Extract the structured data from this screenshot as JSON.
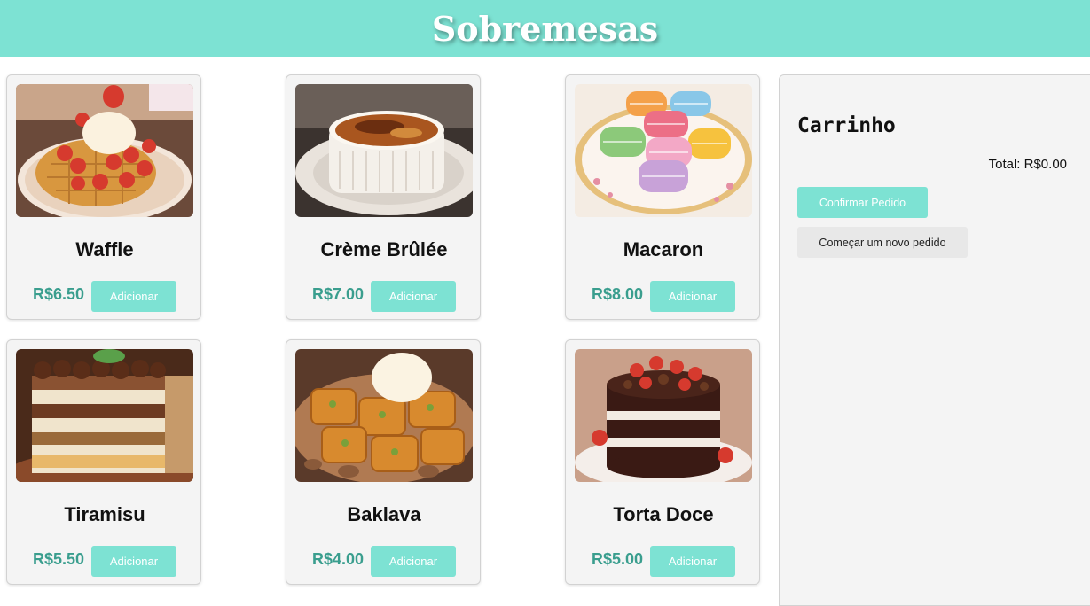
{
  "header": {
    "title": "Sobremesas"
  },
  "products": [
    {
      "name": "Waffle",
      "price": "R$6.50",
      "button": "Adicionar",
      "image": "waffle-photo"
    },
    {
      "name": "Crème Brûlée",
      "price": "R$7.00",
      "button": "Adicionar",
      "image": "creme-brulee-photo"
    },
    {
      "name": "Macaron",
      "price": "R$8.00",
      "button": "Adicionar",
      "image": "macaron-photo"
    },
    {
      "name": "Tiramisu",
      "price": "R$5.50",
      "button": "Adicionar",
      "image": "tiramisu-photo"
    },
    {
      "name": "Baklava",
      "price": "R$4.00",
      "button": "Adicionar",
      "image": "baklava-photo"
    },
    {
      "name": "Torta Doce",
      "price": "R$5.00",
      "button": "Adicionar",
      "image": "cake-photo"
    }
  ],
  "cart": {
    "title": "Carrinho",
    "total": "Total: R$0.00",
    "confirm_label": "Confirmar Pedido",
    "new_order_label": "Começar um novo pedido"
  },
  "colors": {
    "accent": "#7de2d3",
    "price": "#3a9e8e",
    "panel": "#f4f4f4"
  }
}
